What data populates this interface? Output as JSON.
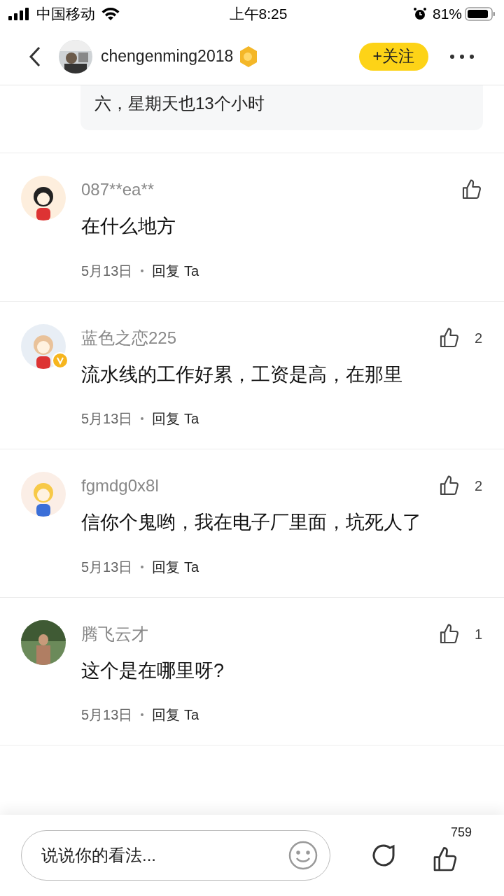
{
  "status_bar": {
    "carrier": "中国移动",
    "time": "上午8:25",
    "battery": "81%"
  },
  "header": {
    "username": "chengenming2018",
    "follow": "+关注"
  },
  "quote": {
    "text": "六，星期天也13个小时"
  },
  "comments": [
    {
      "name": "087**ea**",
      "text": "在什么地方",
      "date": "5月13日",
      "reply": "回复 Ta",
      "verified": false
    },
    {
      "name": "蓝色之恋225",
      "text": "流水线的工作好累，工资是高，在那里",
      "date": "5月13日",
      "reply": "回复 Ta",
      "likes": "2",
      "verified": true
    },
    {
      "name": "fgmdg0x8l",
      "text": "信你个鬼哟，我在电子厂里面，坑死人了",
      "date": "5月13日",
      "reply": "回复 Ta",
      "likes": "2",
      "verified": false
    },
    {
      "name": "腾飞云才",
      "text": "这个是在哪里呀?",
      "date": "5月13日",
      "reply": "回复 Ta",
      "likes": "1",
      "verified": false
    }
  ],
  "bottom_bar": {
    "placeholder": "说说你的看法...",
    "likes": "759"
  }
}
